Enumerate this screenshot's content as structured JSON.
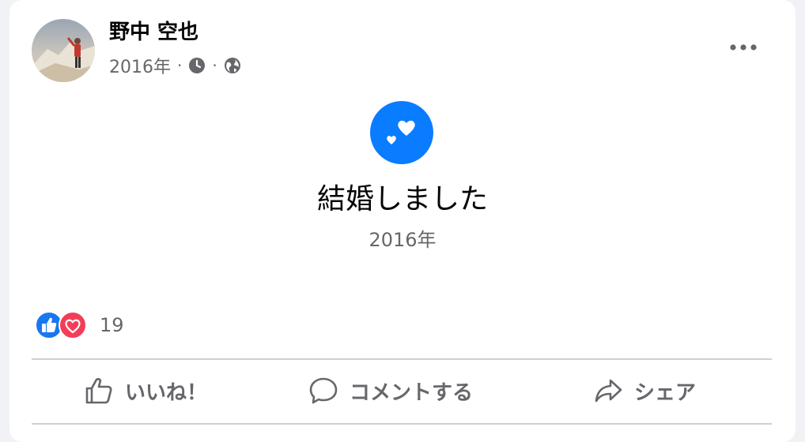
{
  "post": {
    "author_name": "野中 空也",
    "timestamp": "2016年",
    "meta_sep_1": "·",
    "meta_sep_2": "·",
    "privacy_icon": "globe-icon",
    "clock_icon": "clock-icon",
    "more_icon": "more-horizontal-icon"
  },
  "life_event": {
    "icon": "hearts-icon",
    "icon_color": "#0a7cff",
    "title": "結婚しました",
    "year": "2016年"
  },
  "reactions": {
    "types": [
      "like-reaction-icon",
      "love-reaction-icon"
    ],
    "like_color": "#1877f2",
    "love_color": "#f33e58",
    "count": "19"
  },
  "actions": {
    "like_label": "いいね！",
    "comment_label": "コメントする",
    "share_label": "シェア"
  },
  "colors": {
    "background": "#f0f2f5",
    "card": "#ffffff",
    "secondary_text": "#65676b"
  }
}
